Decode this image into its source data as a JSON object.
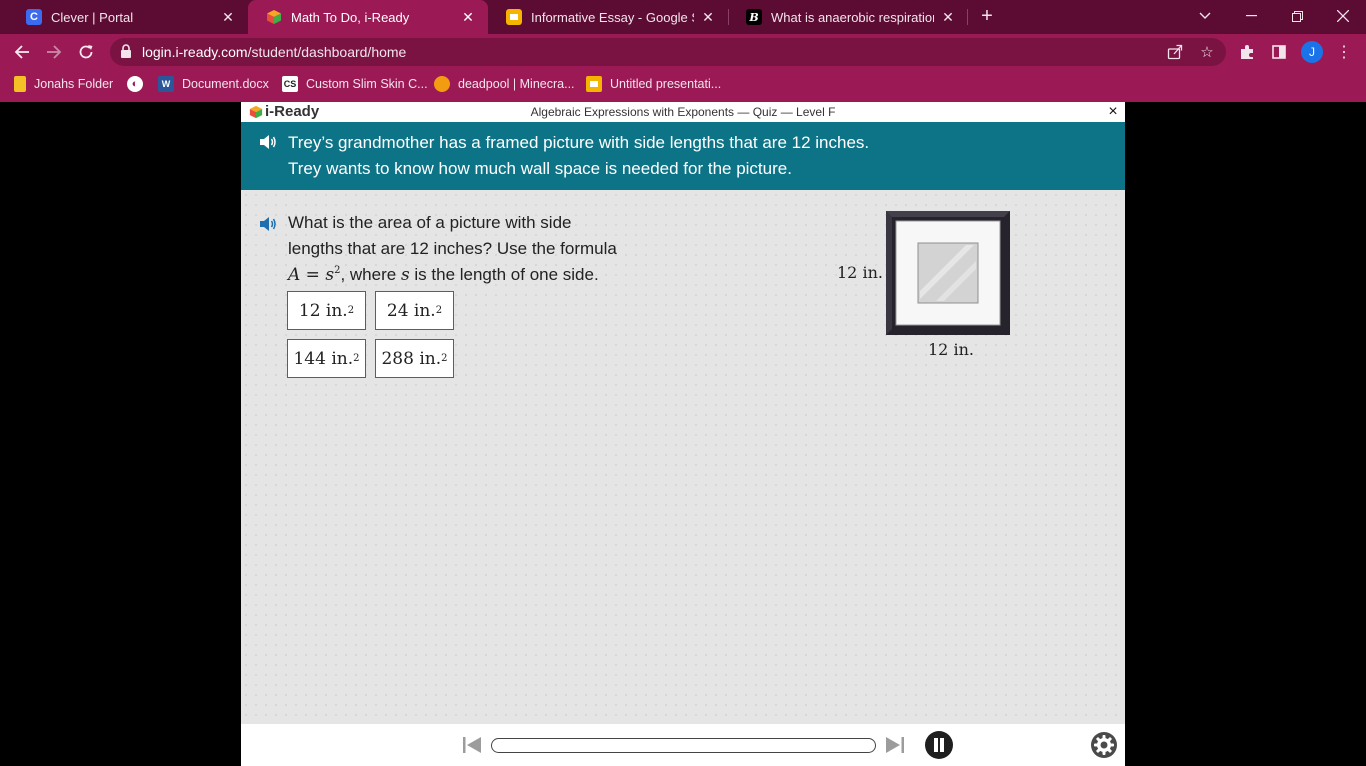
{
  "browser": {
    "tabs": [
      {
        "title": "Clever | Portal",
        "favicon": "clever-icon",
        "active": false
      },
      {
        "title": "Math To Do, i-Ready",
        "favicon": "iready-icon",
        "active": true
      },
      {
        "title": "Informative Essay - Google Slides",
        "favicon": "google-slides-icon",
        "active": false
      },
      {
        "title": "What is anaerobic respiration in y",
        "favicon": "brainly-icon",
        "active": false
      }
    ],
    "url_host": "login.i-ready.com",
    "url_path": "/student/dashboard/home",
    "profile_initial": "J",
    "bookmarks": [
      {
        "label": "Jonahs Folder",
        "icon": "folder-icon"
      },
      {
        "label": "",
        "icon": "globe-icon"
      },
      {
        "label": "Document.docx",
        "icon": "word-icon"
      },
      {
        "label": "Custom Slim Skin C...",
        "icon": "cs-icon"
      },
      {
        "label": "deadpool | Minecra...",
        "icon": "pumpkin-icon"
      },
      {
        "label": "Untitled presentati...",
        "icon": "google-slides-icon"
      }
    ],
    "colors": {
      "tabbar": "#5c0b33",
      "toolbar": "#9b1a55"
    }
  },
  "app": {
    "logo_text": "i-Ready",
    "quiz_title": "Algebraic Expressions with Exponents — Quiz — Level F",
    "close_symbol": "×",
    "banner": {
      "line1": "Trey’s grandmother has a framed picture with side lengths that are 12 inches.",
      "line2": "Trey wants to know how much wall space is needed for the picture."
    },
    "question": {
      "line1": "What is the area of a picture with side",
      "line2": "lengths that are 12 inches? Use the formula",
      "formula_lhs": "A",
      "formula_eq": " = ",
      "formula_var": "s",
      "formula_exp": "2",
      "line3_mid": ", where ",
      "line3_var": "s",
      "line3_end": " is the length of one side."
    },
    "choices": [
      {
        "value": "12 in.",
        "exp": "2"
      },
      {
        "value": "24 in.",
        "exp": "2"
      },
      {
        "value": "144 in.",
        "exp": "2"
      },
      {
        "value": "288 in.",
        "exp": "2"
      }
    ],
    "figure": {
      "side_label": "12 in.",
      "bottom_label": "12 in."
    },
    "colors": {
      "banner": "#0d7487",
      "choice_border": "#1e6fb0"
    }
  }
}
